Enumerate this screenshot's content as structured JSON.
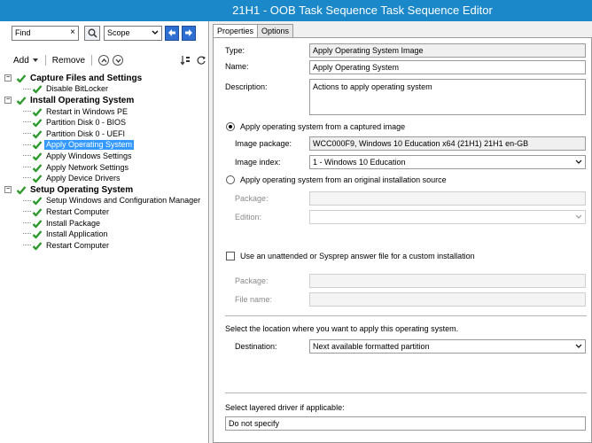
{
  "window": {
    "title": "21H1 - OOB Task Sequence Task Sequence Editor"
  },
  "search": {
    "value": "Find",
    "clear_glyph": "×",
    "scope": "Scope"
  },
  "toolbar": {
    "add_label": "Add",
    "remove_label": "Remove"
  },
  "tree": {
    "groups": [
      {
        "label": "Capture Files and Settings",
        "items": [
          "Disable BitLocker"
        ]
      },
      {
        "label": "Install Operating System",
        "items": [
          "Restart in Windows PE",
          "Partition Disk 0 - BIOS",
          "Partition Disk 0 - UEFI",
          "Apply Operating System",
          "Apply Windows Settings",
          "Apply Network Settings",
          "Apply Device Drivers"
        ]
      },
      {
        "label": "Setup Operating System",
        "items": [
          "Setup Windows and Configuration Manager",
          "Restart Computer",
          "Install Package",
          "Install Application",
          "Restart Computer"
        ]
      }
    ],
    "selected": "Apply Operating System"
  },
  "tabs": [
    "Properties",
    "Options"
  ],
  "properties": {
    "type_label": "Type:",
    "type_value": "Apply Operating System Image",
    "name_label": "Name:",
    "name_value": "Apply Operating System",
    "desc_label": "Description:",
    "desc_value": "Actions to apply operating system",
    "radio_captured": "Apply operating system from a captured image",
    "image_package_label": "Image package:",
    "image_package_value": "WCC000F9, Windows 10 Education x64 (21H1) 21H1 en-GB",
    "image_index_label": "Image index:",
    "image_index_value": "1 - Windows 10 Education",
    "radio_original": "Apply operating system from an original installation source",
    "package_label": "Package:",
    "edition_label": "Edition:",
    "unattend_label": "Use an unattended or Sysprep answer file for a custom installation",
    "unattend_package_label": "Package:",
    "file_name_label": "File name:",
    "location_text": "Select the location where you want to apply this operating system.",
    "destination_label": "Destination:",
    "destination_value": "Next available formatted partition",
    "driver_text": "Select layered driver if applicable:",
    "driver_value": "Do not specify"
  },
  "colors": {
    "titlebar": "#1a88c9",
    "selection": "#3399ff",
    "check": "#2e9a2e"
  },
  "icons": [
    "search-icon",
    "back-arrow-icon",
    "forward-arrow-icon",
    "move-up-icon",
    "move-down-icon",
    "checkmark-icon"
  ]
}
